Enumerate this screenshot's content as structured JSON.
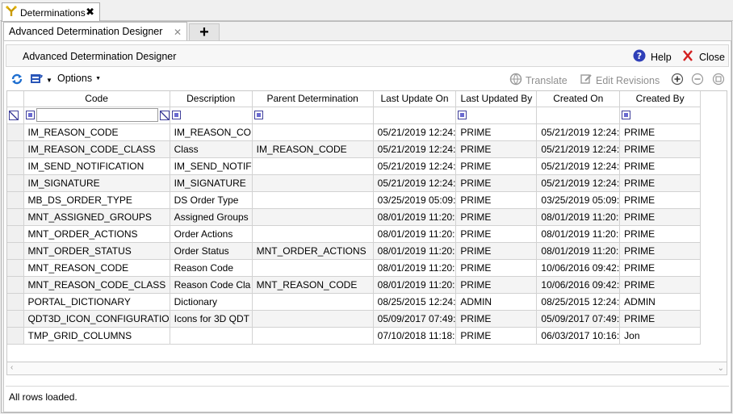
{
  "window": {
    "doc_tab_title": "Determinations",
    "doc_tab_close": "✖",
    "sub_tab_title": "Advanced Determination Designer",
    "sub_tab_close": "✕",
    "add_tab": "+"
  },
  "header": {
    "title": "Advanced Determination Designer",
    "help_label": "Help",
    "close_label": "Close"
  },
  "toolbar": {
    "options_label": "Options",
    "translate_label": "Translate",
    "edit_revisions_label": "Edit Revisions"
  },
  "grid": {
    "columns": [
      "Code",
      "Description",
      "Parent Determination",
      "Last Update On",
      "Last Updated By",
      "Created On",
      "Created By"
    ],
    "rows": [
      [
        "IM_REASON_CODE",
        "IM_REASON_CO",
        "",
        "05/21/2019 12:24:",
        "PRIME",
        "05/21/2019 12:24:",
        "PRIME"
      ],
      [
        "IM_REASON_CODE_CLASS",
        "Class",
        "IM_REASON_CODE",
        "05/21/2019 12:24:",
        "PRIME",
        "05/21/2019 12:24:",
        "PRIME"
      ],
      [
        "IM_SEND_NOTIFICATION",
        "IM_SEND_NOTIF",
        "",
        "05/21/2019 12:24:",
        "PRIME",
        "05/21/2019 12:24:",
        "PRIME"
      ],
      [
        "IM_SIGNATURE",
        "IM_SIGNATURE",
        "",
        "05/21/2019 12:24:",
        "PRIME",
        "05/21/2019 12:24:",
        "PRIME"
      ],
      [
        "MB_DS_ORDER_TYPE",
        "DS Order Type",
        "",
        "03/25/2019 05:09:",
        "PRIME",
        "03/25/2019 05:09:",
        "PRIME"
      ],
      [
        "MNT_ASSIGNED_GROUPS",
        "Assigned Groups",
        "",
        "08/01/2019 11:20:",
        "PRIME",
        "08/01/2019 11:20:",
        "PRIME"
      ],
      [
        "MNT_ORDER_ACTIONS",
        "Order Actions",
        "",
        "08/01/2019 11:20:",
        "PRIME",
        "08/01/2019 11:20:",
        "PRIME"
      ],
      [
        "MNT_ORDER_STATUS",
        "Order Status",
        "MNT_ORDER_ACTIONS",
        "08/01/2019 11:20:",
        "PRIME",
        "08/01/2019 11:20:",
        "PRIME"
      ],
      [
        "MNT_REASON_CODE",
        "Reason Code",
        "",
        "08/01/2019 11:20:",
        "PRIME",
        "10/06/2016 09:42:",
        "PRIME"
      ],
      [
        "MNT_REASON_CODE_CLASS",
        "Reason Code Cla",
        "MNT_REASON_CODE",
        "08/01/2019 11:20:",
        "PRIME",
        "10/06/2016 09:42:",
        "PRIME"
      ],
      [
        "PORTAL_DICTIONARY",
        "Dictionary",
        "",
        "08/25/2015 12:24:",
        "ADMIN",
        "08/25/2015 12:24:",
        "ADMIN"
      ],
      [
        "QDT3D_ICON_CONFIGURATIO",
        "Icons for 3D QDT",
        "",
        "05/09/2017 07:49:",
        "PRIME",
        "05/09/2017 07:49:",
        "PRIME"
      ],
      [
        "TMP_GRID_COLUMNS",
        "",
        "",
        "07/10/2018 11:18:",
        "PRIME",
        "06/03/2017 10:16:",
        "Jon"
      ]
    ]
  },
  "status": {
    "text": "All rows loaded."
  },
  "icons": {
    "doc": "determination-icon",
    "help": "help-icon",
    "close": "close-icon",
    "refresh": "refresh-icon",
    "export": "export-icon",
    "translate": "translate-icon",
    "edit_revisions": "edit-revisions-icon",
    "expand": "expand-all-icon",
    "collapse": "collapse-all-icon",
    "settings": "grid-settings-icon"
  }
}
